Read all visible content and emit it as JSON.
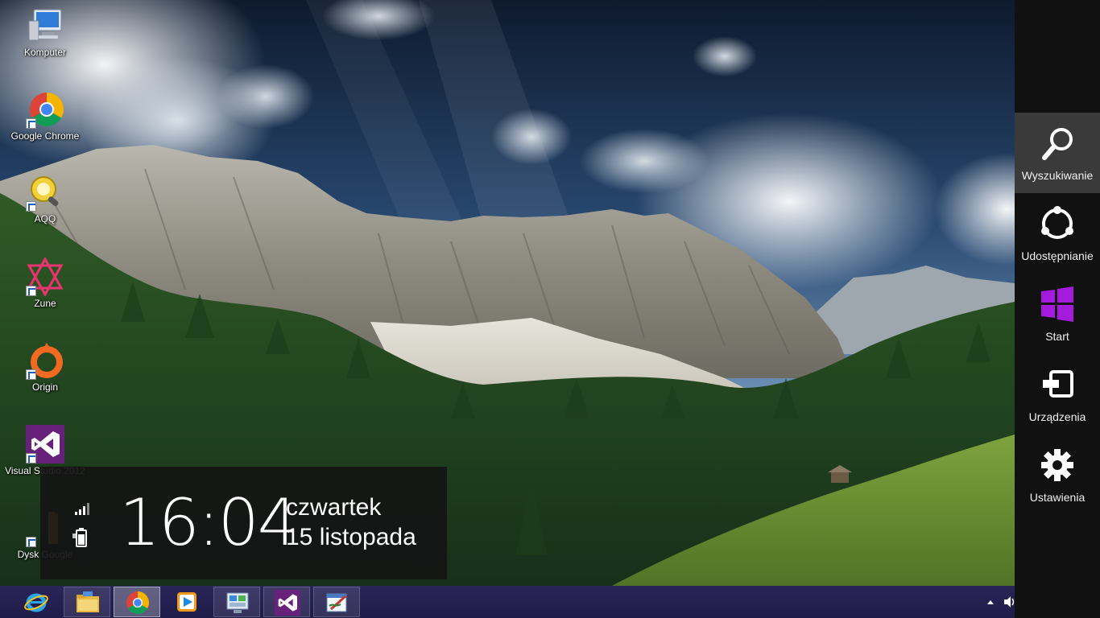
{
  "desktop": {
    "icons": [
      {
        "label": "Komputer",
        "icon": "computer-icon"
      },
      {
        "label": "Google Chrome",
        "icon": "chrome-icon"
      },
      {
        "label": "AQQ",
        "icon": "aqq-icon"
      },
      {
        "label": "Zune",
        "icon": "zune-icon"
      },
      {
        "label": "Origin",
        "icon": "origin-icon"
      },
      {
        "label": "Visual Studio 2012",
        "icon": "visual-studio-icon"
      },
      {
        "label": "Dysk Google",
        "icon": "folder-icon"
      }
    ]
  },
  "clock": {
    "time": "16:04",
    "day": "czwartek",
    "date": "15 listopada"
  },
  "charms": [
    {
      "label": "Wyszukiwanie",
      "icon": "search-icon",
      "active": true
    },
    {
      "label": "Udostępnianie",
      "icon": "share-icon"
    },
    {
      "label": "Start",
      "icon": "windows-logo-icon"
    },
    {
      "label": "Urządzenia",
      "icon": "devices-icon"
    },
    {
      "label": "Ustawienia",
      "icon": "gear-icon"
    }
  ],
  "taskbar": {
    "buttons": [
      {
        "name": "internet-explorer",
        "icon": "internet-explorer-icon",
        "state": "pinned"
      },
      {
        "name": "file-explorer",
        "icon": "folder-icon",
        "state": "open"
      },
      {
        "name": "google-chrome",
        "icon": "chrome-icon",
        "state": "active"
      },
      {
        "name": "media-player",
        "icon": "media-player-icon",
        "state": "pinned"
      },
      {
        "name": "control-panel",
        "icon": "control-panel-icon",
        "state": "open"
      },
      {
        "name": "visual-studio",
        "icon": "visual-studio-icon",
        "state": "open"
      },
      {
        "name": "paint",
        "icon": "paint-icon",
        "state": "open"
      }
    ],
    "tray": [
      "show-hidden-icons-arrow",
      "volume-icon"
    ]
  },
  "colors": {
    "charms_bg": "#111111",
    "charm_active_bg": "#3a3a3a",
    "start_purple": "#a31bdc",
    "taskbar": "#231f50",
    "clock_panel": "#141414"
  }
}
